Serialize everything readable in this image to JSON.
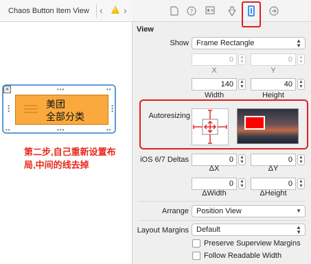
{
  "editor": {
    "title": "Chaos Button Item View",
    "item": {
      "line1": "美团",
      "line2": "全部分类"
    },
    "annotation": "第二步,自己重新设置布局,中间的线去掉"
  },
  "inspector": {
    "tabs": [
      "file-icon",
      "help-icon",
      "identity-icon",
      "attributes-icon",
      "size-icon",
      "connections-icon"
    ],
    "section_title": "View",
    "show": {
      "label": "Show",
      "value": "Frame Rectangle"
    },
    "x_field": {
      "value": "0",
      "label": "X"
    },
    "y_field": {
      "value": "0",
      "label": "Y"
    },
    "width_field": {
      "value": "140",
      "label": "Width"
    },
    "height_field": {
      "value": "40",
      "label": "Height"
    },
    "autoresizing_label": "Autoresizing",
    "deltas": {
      "label": "iOS 6/7 Deltas",
      "dx": {
        "value": "0",
        "label": "ΔX"
      },
      "dy": {
        "value": "0",
        "label": "ΔY"
      },
      "dwidth": {
        "value": "0",
        "label": "ΔWidth"
      },
      "dheight": {
        "value": "0",
        "label": "ΔHeight"
      }
    },
    "arrange": {
      "label": "Arrange",
      "value": "Position View"
    },
    "layout_margins": {
      "label": "Layout Margins",
      "value": "Default"
    },
    "checkboxes": [
      {
        "label": "Preserve Superview Margins",
        "checked": false
      },
      {
        "label": "Follow Readable Width",
        "checked": false
      }
    ]
  },
  "colors": {
    "highlight": "#e21d1d",
    "accent": "#3d8ff5",
    "button_fill": "#f9a93d"
  }
}
